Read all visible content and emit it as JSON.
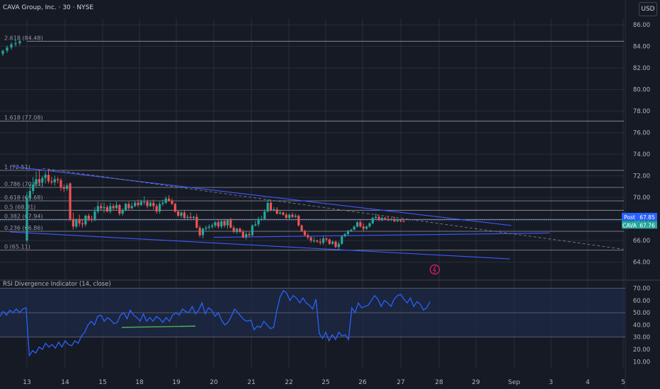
{
  "header": {
    "title": "CAVA Group, Inc. · 30 · NYSE",
    "currency": "USD"
  },
  "indicator": {
    "title": "RSI Divergence Indicator (14, close)"
  },
  "colors": {
    "bg": "#161a25",
    "up": "#26a69a",
    "down": "#ef5350",
    "channel": "#3d5afe",
    "rsi": "#2962ff",
    "grid": "#2a2e39"
  },
  "chart_data": [
    {
      "type": "candlestick",
      "title": "CAVA Group, Inc. · 30 · NYSE",
      "ylim": [
        62.6,
        86.6
      ],
      "y_ticks": [
        "86.00",
        "84.00",
        "82.00",
        "80.00",
        "78.00",
        "76.00",
        "74.00",
        "72.00",
        "70.00",
        "68.00",
        "66.00",
        "64.00"
      ],
      "x_tick_labels": [
        "13",
        "14",
        "15",
        "18",
        "19",
        "20",
        "21",
        "22",
        "25",
        "26",
        "27",
        "28",
        "29",
        "Sep",
        "3",
        "4",
        "5"
      ],
      "fib_levels": [
        {
          "label": "2.618 (84.48)",
          "value": 84.48
        },
        {
          "label": "1.618 (77.08)",
          "value": 77.08
        },
        {
          "label": "1 (72.51)",
          "value": 72.51
        },
        {
          "label": "0.786 (70.93)",
          "value": 70.93
        },
        {
          "label": "0.618 (69.68)",
          "value": 69.68
        },
        {
          "label": "0.5 (68.81)",
          "value": 68.81
        },
        {
          "label": "0.382 (67.94)",
          "value": 67.94
        },
        {
          "label": "0.236 (66.86)",
          "value": 66.86
        },
        {
          "label": "0 (65.11)",
          "value": 65.11
        }
      ],
      "price_labels": [
        {
          "name": "Post",
          "value": "67.85",
          "color": "#2962ff"
        },
        {
          "name": "CAVA",
          "value": "67.76",
          "color": "#26a69a"
        }
      ],
      "series": [
        {
          "name": "open",
          "values": [
            83.3,
            83.6,
            83.9,
            84.2,
            84.3,
            66.0,
            70.0,
            70.6,
            71.2,
            71.7,
            71.4,
            71.8,
            72.1,
            71.5,
            71.4,
            71.7,
            71.6,
            70.9,
            70.8,
            71.3,
            68.0,
            67.3,
            68.0,
            67.6,
            67.5,
            68.3,
            68.0,
            67.9,
            68.7,
            69.2,
            69.0,
            69.1,
            68.7,
            69.2,
            69.0,
            69.3,
            68.5,
            68.8,
            69.4,
            69.0,
            69.2,
            69.5,
            69.3,
            69.6,
            69.6,
            69.2,
            69.5,
            69.2,
            68.7,
            69.4,
            69.5,
            69.9,
            69.7,
            69.4,
            68.7,
            68.3,
            68.6,
            68.1,
            68.2,
            68.1,
            68.2,
            67.2,
            66.5,
            67.1,
            67.2,
            67.3,
            67.4,
            67.7,
            67.3,
            67.8,
            67.4,
            67.9,
            67.2,
            66.8,
            67.1,
            66.8,
            66.3,
            66.6,
            66.5,
            67.4,
            67.5,
            68.0,
            68.0,
            68.7,
            69.5,
            68.8,
            68.9,
            68.5,
            68.6,
            68.4,
            68.1,
            68.4,
            68.2,
            68.3,
            67.4,
            66.9,
            66.5,
            66.3,
            66.0,
            66.0,
            65.9,
            65.8,
            66.2,
            66.1,
            65.7,
            65.9,
            65.4,
            65.7,
            66.4,
            66.6,
            66.9,
            67.0,
            67.3,
            67.7,
            67.3,
            67.1,
            67.3,
            67.6,
            68.1,
            68.2,
            67.9,
            68.1,
            68.0,
            67.9,
            68.0,
            67.8,
            67.9,
            67.8
          ],
          "note": "open"
        },
        {
          "name": "high",
          "values": [
            83.7,
            84.1,
            84.4,
            84.6,
            84.7,
            70.5,
            71.2,
            71.9,
            72.4,
            72.5,
            72.0,
            72.4,
            72.6,
            71.9,
            72.0,
            71.9,
            71.8,
            71.2,
            71.3,
            71.4,
            68.6,
            68.0,
            68.4,
            68.0,
            68.4,
            68.5,
            68.3,
            69.1,
            69.6,
            69.5,
            69.5,
            69.3,
            69.5,
            69.4,
            69.6,
            69.4,
            69.0,
            69.5,
            69.6,
            69.5,
            69.7,
            69.8,
            69.8,
            70.1,
            69.8,
            69.7,
            69.8,
            69.4,
            69.6,
            69.8,
            70.1,
            70.2,
            69.9,
            69.5,
            68.8,
            68.7,
            68.8,
            68.4,
            68.6,
            68.3,
            68.5,
            67.4,
            67.2,
            67.4,
            67.5,
            67.6,
            67.8,
            67.9,
            67.9,
            68.0,
            68.0,
            68.1,
            67.4,
            67.2,
            67.2,
            67.0,
            66.9,
            66.8,
            67.5,
            67.8,
            68.2,
            68.3,
            68.9,
            69.8,
            69.7,
            69.1,
            69.1,
            68.8,
            68.7,
            68.6,
            68.5,
            68.6,
            68.5,
            68.4,
            67.5,
            67.0,
            66.7,
            66.4,
            66.3,
            66.1,
            66.2,
            66.4,
            66.3,
            66.2,
            66.0,
            66.0,
            65.9,
            66.5,
            66.7,
            67.0,
            67.1,
            67.4,
            67.8,
            67.9,
            67.6,
            67.4,
            67.7,
            68.2,
            68.5,
            68.4,
            68.2,
            68.2,
            68.2,
            68.1,
            68.2,
            68.0,
            68.0,
            67.9
          ],
          "note": "high"
        },
        {
          "name": "low",
          "values": [
            83.1,
            83.4,
            83.7,
            84.0,
            84.1,
            65.8,
            69.7,
            70.3,
            70.9,
            71.1,
            71.0,
            71.3,
            71.3,
            71.2,
            71.1,
            71.3,
            70.6,
            70.5,
            70.6,
            67.8,
            67.0,
            67.1,
            67.3,
            67.2,
            67.3,
            67.8,
            67.7,
            67.8,
            68.5,
            68.8,
            68.6,
            68.6,
            68.5,
            68.8,
            68.9,
            68.3,
            68.3,
            68.7,
            68.8,
            68.9,
            69.1,
            69.1,
            69.2,
            69.3,
            69.0,
            69.1,
            68.9,
            68.5,
            68.5,
            69.2,
            69.4,
            69.6,
            69.3,
            68.6,
            68.2,
            68.1,
            67.9,
            67.9,
            68.0,
            68.0,
            67.1,
            66.3,
            66.2,
            66.9,
            67.0,
            67.1,
            67.2,
            67.1,
            67.1,
            67.2,
            67.1,
            67.1,
            66.7,
            66.6,
            66.7,
            66.2,
            66.1,
            66.3,
            66.4,
            67.3,
            67.3,
            67.8,
            67.9,
            68.6,
            68.7,
            68.7,
            68.4,
            68.4,
            68.3,
            68.0,
            67.9,
            68.1,
            68.1,
            67.3,
            66.8,
            66.4,
            66.1,
            65.8,
            65.8,
            65.8,
            65.6,
            65.6,
            65.9,
            65.6,
            65.6,
            65.3,
            65.2,
            65.6,
            66.3,
            66.5,
            66.8,
            67.0,
            67.2,
            67.2,
            66.9,
            67.0,
            67.2,
            67.5,
            67.9,
            67.8,
            67.8,
            67.9,
            67.8,
            67.8,
            67.7,
            67.7,
            67.7,
            67.7
          ],
          "note": "low"
        },
        {
          "name": "close",
          "values": [
            83.6,
            83.9,
            84.2,
            84.3,
            84.5,
            70.0,
            70.6,
            71.2,
            71.7,
            71.4,
            71.8,
            72.1,
            71.5,
            71.4,
            71.7,
            71.6,
            70.9,
            70.8,
            71.1,
            68.0,
            67.3,
            68.0,
            67.6,
            67.5,
            68.3,
            68.0,
            67.9,
            68.7,
            69.2,
            69.0,
            69.1,
            68.7,
            69.2,
            69.0,
            69.3,
            68.5,
            68.8,
            69.4,
            69.0,
            69.2,
            69.5,
            69.3,
            69.6,
            69.6,
            69.2,
            69.5,
            69.2,
            68.7,
            69.4,
            69.5,
            69.9,
            69.7,
            69.4,
            68.7,
            68.3,
            68.6,
            68.1,
            68.2,
            68.1,
            68.2,
            67.2,
            66.5,
            67.1,
            67.2,
            67.3,
            67.4,
            67.7,
            67.3,
            67.8,
            67.4,
            67.9,
            67.2,
            66.8,
            67.1,
            66.8,
            66.3,
            66.6,
            66.5,
            67.4,
            67.5,
            68.0,
            68.0,
            68.7,
            69.5,
            68.8,
            68.9,
            68.5,
            68.6,
            68.4,
            68.1,
            68.4,
            68.2,
            68.3,
            67.4,
            66.9,
            66.5,
            66.3,
            66.0,
            66.0,
            65.9,
            65.8,
            66.2,
            66.1,
            65.7,
            65.9,
            65.4,
            65.7,
            66.4,
            66.6,
            66.9,
            67.0,
            67.3,
            67.7,
            67.3,
            67.1,
            67.3,
            67.6,
            68.1,
            68.2,
            67.9,
            68.1,
            68.0,
            67.9,
            68.0,
            67.8,
            67.9,
            67.8,
            67.76
          ],
          "note": "close"
        }
      ]
    },
    {
      "type": "line",
      "title": "RSI Divergence Indicator (14, close)",
      "ylim": [
        5,
        72
      ],
      "y_ticks": [
        "70.00",
        "60.00",
        "50.00",
        "40.00",
        "30.00",
        "20.00",
        "10.00"
      ],
      "series": [
        {
          "name": "RSI",
          "values": [
            47,
            51,
            48,
            52,
            50,
            53,
            50,
            53,
            54,
            15,
            19,
            17,
            22,
            20,
            25,
            22,
            24,
            21,
            26,
            22,
            27,
            24,
            23,
            27,
            25,
            31,
            34,
            40,
            43,
            40,
            47,
            48,
            43,
            46,
            44,
            41,
            42,
            48,
            50,
            45,
            52,
            48,
            46,
            43,
            49,
            43,
            46,
            43,
            47,
            45,
            42,
            46,
            43,
            48,
            50,
            48,
            53,
            51,
            50,
            55,
            49,
            52,
            58,
            49,
            54,
            52,
            47,
            50,
            44,
            40,
            42,
            47,
            53,
            50,
            47,
            44,
            43,
            44,
            36,
            39,
            38,
            43,
            40,
            37,
            38,
            52,
            63,
            68,
            66,
            60,
            64,
            62,
            58,
            62,
            58,
            56,
            53,
            61,
            33,
            29,
            34,
            27,
            32,
            28,
            34,
            31,
            32,
            28,
            54,
            50,
            58,
            54,
            55,
            56,
            60,
            64,
            61,
            55,
            60,
            58,
            55,
            61,
            64,
            65,
            61,
            58,
            62,
            55,
            59,
            57,
            52,
            54,
            59
          ]
        }
      ]
    }
  ]
}
